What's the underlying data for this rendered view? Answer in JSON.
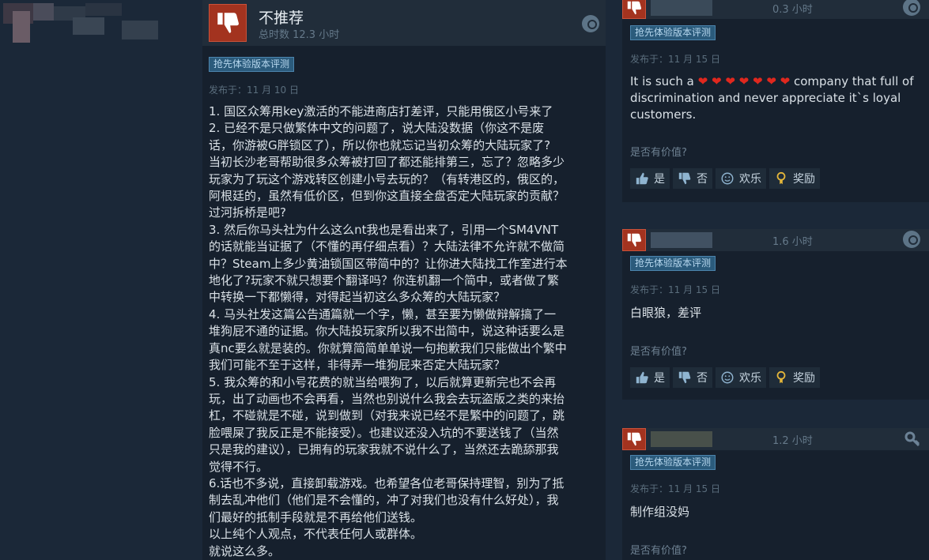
{
  "main_review": {
    "verdict": "不推荐",
    "hours": "总时数 12.3 小时",
    "badge": "抢先体验版本评测",
    "posted": "发布于：11 月 10 日",
    "body": "1. 国区众筹用key激活的不能进商店打差评，只能用俄区小号来了\n2. 已经不是只做繁体中文的问题了，说大陆没数据（你这不是废\n话，你游被G胖锁区了），所以你也就忘记当初众筹的大陆玩家了?\n当初长沙老哥帮助很多众筹被打回了都还能排第三，忘了？忽略多少\n玩家为了玩这个游戏转区创建小号去玩的？（有转港区的，俄区的，\n阿根廷的，虽然有低价区，但到你这直接全盘否定大陆玩家的贡献？\n过河拆桥是吧?\n3. 然后你马头社为什么这么nt我也是看出来了，引用一个SM4VNT\n的话就能当证据了（不懂的再仔细点看）？大陆法律不允许就不做简\n中？Steam上多少黄油锁国区带简中的？让你进大陆找工作室进行本\n地化了?玩家不就只想要个翻译吗？你连机翻一个简中，或者做了繁\n中转换一下都懒得，对得起当初这么多众筹的大陆玩家？\n4. 马头社发这篇公告通篇就一个字，懒，甚至要为懒做辩解搞了一\n堆狗屁不通的证据。你大陆投玩家所以我不出简中，说这种话要么是\n真nc要么就是装的。你就算简简单单说一句抱歉我们只能做出个繁中\n我们可能不至于这样，非得弄一堆狗屁来否定大陆玩家？\n5. 我众筹的和小号花费的就当给喂狗了，以后就算更新完也不会再\n玩，出了动画也不会再看，当然也别说什么我会去玩盗版之类的来抬\n杠，不碰就是不碰，说到做到（对我来说已经不是繁中的问题了，跳\n脸喂屎了我反正是不能接受）。也建议还没入坑的不要送钱了（当然\n只是我的建议），已拥有的玩家我就不说什么了，当然还去跪舔那我\n觉得不行。\n6.话也不多说，直接卸载游戏。也希望各位老哥保持理智，别为了抵\n制去乱冲他们（他们是不会懂的，冲了对我们也没有什么好处），我\n们最好的抵制手段就是不再给他们送钱。\n以上纯个人观点，不代表任何人或群体。\n就说这么多。"
  },
  "side_reviews": [
    {
      "hours": "0.3 小时",
      "badge": "抢先体验版本评测",
      "posted": "发布于：11 月 15 日",
      "text_before": "It is such a ",
      "hearts": "❤ ❤ ❤ ❤ ❤ ❤ ❤",
      "text_after": " company that full of discrimination and never appreciate it`s loyal customers.",
      "helpful_q": "是否有价值?",
      "btn_yes": "是",
      "btn_no": "否",
      "btn_funny": "欢乐",
      "btn_award": "奖励"
    },
    {
      "hours": "1.6 小时",
      "badge": "抢先体验版本评测",
      "posted": "发布于：11 月 15 日",
      "text": "白眼狼，差评",
      "helpful_q": "是否有价值?",
      "btn_yes": "是",
      "btn_no": "否",
      "btn_funny": "欢乐",
      "btn_award": "奖励"
    },
    {
      "hours": "1.2 小时",
      "badge": "抢先体验版本评测",
      "posted": "发布于：11 月 15 日",
      "text": "制作组没妈",
      "helpful_q": "是否有价值?"
    }
  ],
  "colors": {
    "thumb_down": "#a3331f",
    "badge_bg": "#2b5b7c",
    "heart": "#e0281e"
  }
}
